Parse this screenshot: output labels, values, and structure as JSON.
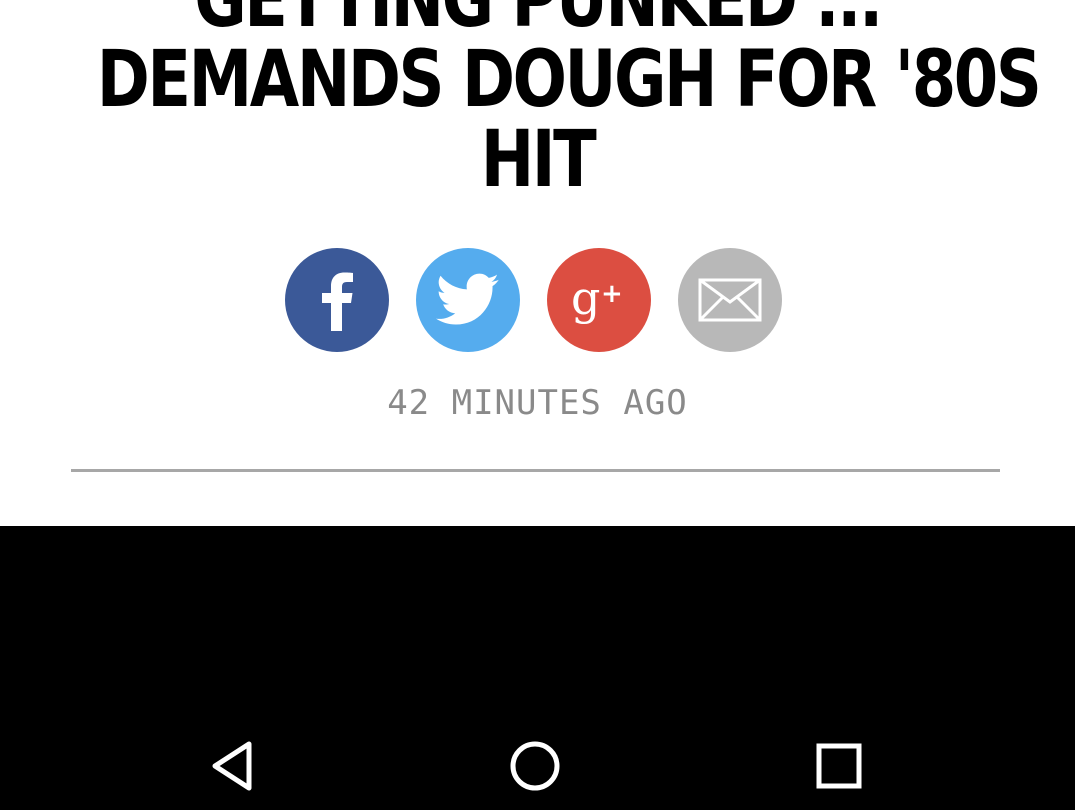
{
  "article": {
    "headline_lines": [
      "GETTING PUNKED ...",
      "DEMANDS DOUGH FOR '80S",
      "HIT"
    ],
    "timestamp": "42 MINUTES AGO"
  },
  "share": [
    {
      "name": "facebook",
      "icon": "facebook-icon",
      "color": "#3b5998"
    },
    {
      "name": "twitter",
      "icon": "twitter-icon",
      "color": "#55acee"
    },
    {
      "name": "google-plus",
      "icon": "google-plus-icon",
      "color": "#dc4e41"
    },
    {
      "name": "email",
      "icon": "mail-icon",
      "color": "#b8b8b8"
    }
  ],
  "navigation_bar": {
    "buttons": [
      "back",
      "home",
      "recents"
    ],
    "icons": [
      "back-triangle-icon",
      "home-circle-icon",
      "recents-square-icon"
    ]
  }
}
